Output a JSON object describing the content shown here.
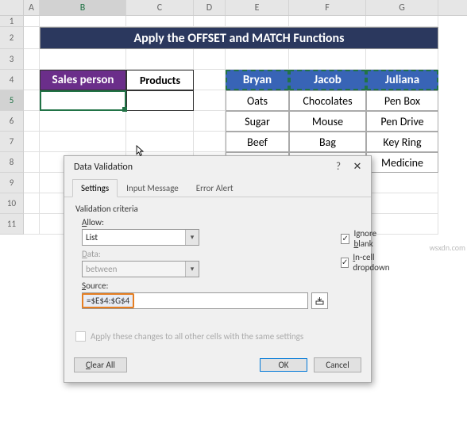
{
  "columns": [
    "A",
    "B",
    "C",
    "D",
    "E",
    "F",
    "G"
  ],
  "rows": [
    "1",
    "2",
    "3",
    "4",
    "5",
    "6",
    "7",
    "8",
    "9",
    "10",
    "11"
  ],
  "title": "Apply the OFFSET and MATCH Functions",
  "table_left": {
    "headers": [
      "Sales person",
      "Products"
    ]
  },
  "table_right": {
    "headers": [
      "Bryan",
      "Jacob",
      "Juliana"
    ],
    "rows": [
      [
        "Oats",
        "Chocolates",
        "Pen Box"
      ],
      [
        "Sugar",
        "Mouse",
        "Pen Drive"
      ],
      [
        "Beef",
        "Bag",
        "Key Ring"
      ],
      [
        "",
        "",
        "Medicine"
      ]
    ]
  },
  "dialog": {
    "title": "Data Validation",
    "tabs": [
      "Settings",
      "Input Message",
      "Error Alert"
    ],
    "criteria_label": "Validation criteria",
    "allow_label": "Allow:",
    "allow_value": "List",
    "data_label": "Data:",
    "data_value": "between",
    "source_label": "Source:",
    "source_value": "=$E$4:$G$4",
    "ignore_blank": "Ignore blank",
    "incell_dropdown": "In-cell dropdown",
    "apply_label": "Apply these changes to all other cells with the same settings",
    "clear_all": "Clear All",
    "ok": "OK",
    "cancel": "Cancel"
  },
  "watermark": "wsxdn.com"
}
